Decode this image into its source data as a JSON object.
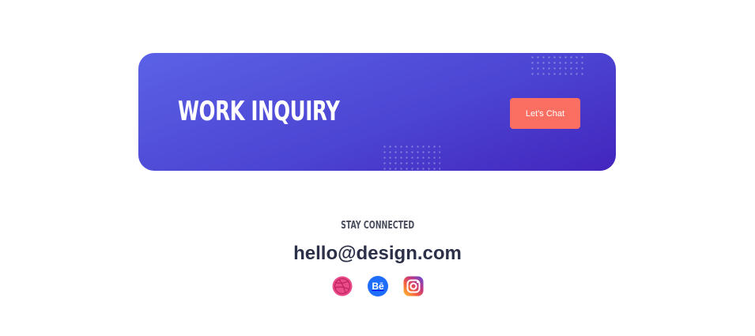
{
  "banner": {
    "title": "WORK INQUIRY",
    "cta_label": "Let's Chat"
  },
  "connect": {
    "label": "STAY CONNECTED",
    "email": "hello@design.com"
  },
  "socials": [
    {
      "name": "dribbble",
      "icon": "dribbble-icon",
      "color": "#ea4c89"
    },
    {
      "name": "behance",
      "icon": "behance-icon",
      "color": "#1f6dfb",
      "glyph": "Bē"
    },
    {
      "name": "instagram",
      "icon": "instagram-icon",
      "color": "#c13584"
    }
  ],
  "colors": {
    "banner_start": "#5b62e6",
    "banner_end": "#4325bd",
    "cta": "#fb6f62",
    "email_text": "#2c3048"
  }
}
